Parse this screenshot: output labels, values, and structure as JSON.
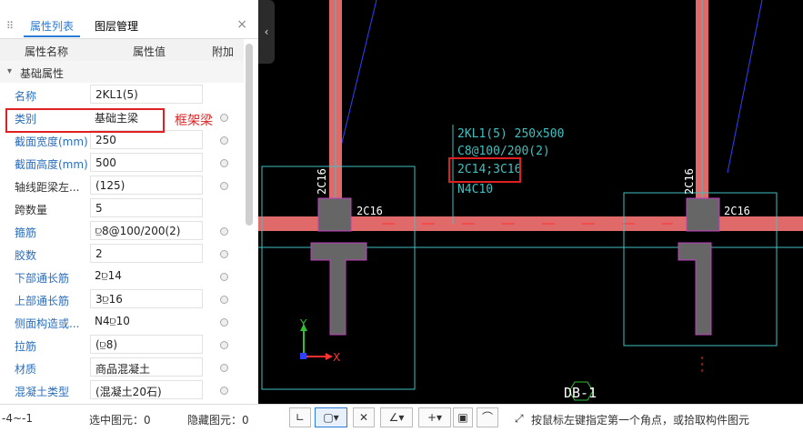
{
  "panel": {
    "tabs": [
      {
        "label": "属性列表"
      },
      {
        "label": "图层管理"
      }
    ],
    "close": "×",
    "columns": {
      "name": "属性名称",
      "value": "属性值",
      "extra": "附加"
    },
    "group": {
      "toggle": "▾",
      "label": "基础属性"
    },
    "rows": [
      {
        "name": "名称",
        "value": "2KL1(5)"
      },
      {
        "name": "类别",
        "value": "基础主梁"
      },
      {
        "name": "截面宽度(mm)",
        "value": "250"
      },
      {
        "name": "截面高度(mm)",
        "value": "500"
      },
      {
        "name": "轴线距梁左...",
        "value": "(125)"
      },
      {
        "name": "跨数量",
        "value": "5"
      },
      {
        "name": "箍筋",
        "value": "⫒8@100/200(2)"
      },
      {
        "name": "胶数",
        "value": "2"
      },
      {
        "name": "下部通长筋",
        "value": "2⫒14"
      },
      {
        "name": "上部通长筋",
        "value": "3⫒16"
      },
      {
        "name": "侧面构造或...",
        "value": "N4⫒10"
      },
      {
        "name": "拉筋",
        "value": "(⫒8)"
      },
      {
        "name": "材质",
        "value": "商品混凝土"
      },
      {
        "name": "混凝土类型",
        "value": "(混凝土20石)"
      }
    ],
    "annotation": "框架梁"
  },
  "status": {
    "left": "-4~-1",
    "selected": "选中图元：0",
    "hidden": "隐藏图元：0",
    "hint": "按鼠标左键指定第一个角点，或拾取构件图元"
  },
  "cad": {
    "beam_label": [
      "2KL1(5) 250x500",
      "C8@100/200(2)",
      "2C14;3C16",
      "N4C10"
    ],
    "bar_left_vertical": "2C16",
    "bar_left_horizontal": "2C16",
    "bar_right_vertical": "2C16",
    "bar_right_horizontal": "2C16",
    "axis_y": "Y",
    "axis_x": "X",
    "sheet_label": "DB-1",
    "colors": {
      "beam": "#e06a6a",
      "section": "#666666",
      "outline": "#c040c0",
      "cyan": "#40c0c0",
      "blue": "#3040ff",
      "text": "#40c0c0"
    }
  }
}
